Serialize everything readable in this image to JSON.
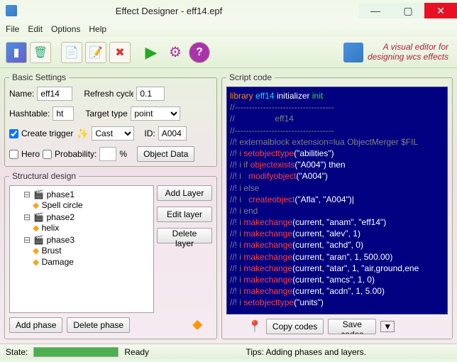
{
  "window": {
    "title": "Effect Designer - eff14.epf",
    "tagline_line1": "A visual editor for",
    "tagline_line2": "designing wcs effects"
  },
  "menu": {
    "file": "File",
    "edit": "Edit",
    "options": "Options",
    "help": "Help"
  },
  "basic": {
    "legend": "Basic Settings",
    "name_label": "Name:",
    "name_value": "eff14",
    "refresh_label": "Refresh cycle:",
    "refresh_value": "0.1",
    "hash_label": "Hashtable:",
    "hash_value": "ht",
    "target_label": "Target type:",
    "target_value": "point",
    "create_trigger_label": "Create trigger",
    "create_trigger_checked": true,
    "cast_value": "Cast",
    "id_label": "ID:",
    "id_value": "A004",
    "hero_label": "Hero",
    "hero_checked": false,
    "prob_label": "Probability:",
    "prob_value": "",
    "prob_unit": "%",
    "object_data_label": "Object Data"
  },
  "struct": {
    "legend": "Structural design",
    "tree": [
      {
        "label": "phase1",
        "children": [
          {
            "label": "Spell circle"
          }
        ]
      },
      {
        "label": "phase2",
        "children": [
          {
            "label": "helix"
          }
        ]
      },
      {
        "label": "phase3",
        "children": [
          {
            "label": "Brust"
          },
          {
            "label": "Damage"
          }
        ]
      }
    ],
    "add_layer": "Add Layer",
    "edit_layer": "Edit layer",
    "delete_layer": "Delete layer",
    "add_phase": "Add phase",
    "delete_phase": "Delete phase"
  },
  "script": {
    "legend": "Script code",
    "copy": "Copy codes",
    "save": "Save codes",
    "lines": [
      {
        "segs": [
          {
            "t": "library ",
            "c": "kw-orange"
          },
          {
            "t": "eff14",
            "c": "kw-cyan"
          },
          {
            "t": " initializer ",
            "c": "kw-white"
          },
          {
            "t": "init",
            "c": "kw-green"
          }
        ]
      },
      {
        "segs": [
          {
            "t": "//-----------------------------------",
            "c": "kw-gray"
          }
        ]
      },
      {
        "segs": [
          {
            "t": "//                 eff14",
            "c": "kw-gray"
          }
        ]
      },
      {
        "segs": [
          {
            "t": "//-----------------------------------",
            "c": "kw-gray"
          }
        ]
      },
      {
        "segs": [
          {
            "t": "//! externalblock extension=lua ObjectMerger $FIL",
            "c": "kw-gray"
          }
        ]
      },
      {
        "segs": [
          {
            "t": "//! i ",
            "c": "kw-gray"
          },
          {
            "t": "setobjecttype",
            "c": "kw-red"
          },
          {
            "t": "(\"abilities\")",
            "c": "kw-white"
          }
        ]
      },
      {
        "segs": [
          {
            "t": "//! i if ",
            "c": "kw-gray"
          },
          {
            "t": "objectexists",
            "c": "kw-red"
          },
          {
            "t": "(\"A004\") then",
            "c": "kw-white"
          }
        ]
      },
      {
        "segs": [
          {
            "t": "//! i   ",
            "c": "kw-gray"
          },
          {
            "t": "modifyobject",
            "c": "kw-red"
          },
          {
            "t": "(\"A004\")",
            "c": "kw-white"
          }
        ]
      },
      {
        "segs": [
          {
            "t": "//! i else",
            "c": "kw-gray"
          }
        ]
      },
      {
        "segs": [
          {
            "t": "//! i   ",
            "c": "kw-gray"
          },
          {
            "t": "createobject",
            "c": "kw-red"
          },
          {
            "t": "(\"Afla\", \"A004\")",
            "c": "kw-white"
          },
          {
            "t": "|",
            "c": "kw-white"
          }
        ]
      },
      {
        "segs": [
          {
            "t": "//! i end",
            "c": "kw-gray"
          }
        ]
      },
      {
        "segs": [
          {
            "t": "//! i ",
            "c": "kw-gray"
          },
          {
            "t": "makechange",
            "c": "kw-red"
          },
          {
            "t": "(current, \"anam\", \"eff14\")",
            "c": "kw-white"
          }
        ]
      },
      {
        "segs": [
          {
            "t": "//! i ",
            "c": "kw-gray"
          },
          {
            "t": "makechange",
            "c": "kw-red"
          },
          {
            "t": "(current, \"alev\", 1)",
            "c": "kw-white"
          }
        ]
      },
      {
        "segs": [
          {
            "t": "//! i ",
            "c": "kw-gray"
          },
          {
            "t": "makechange",
            "c": "kw-red"
          },
          {
            "t": "(current, \"achd\", 0)",
            "c": "kw-white"
          }
        ]
      },
      {
        "segs": [
          {
            "t": "//! i ",
            "c": "kw-gray"
          },
          {
            "t": "makechange",
            "c": "kw-red"
          },
          {
            "t": "(current, \"aran\", 1, 500.00)",
            "c": "kw-white"
          }
        ]
      },
      {
        "segs": [
          {
            "t": "//! i ",
            "c": "kw-gray"
          },
          {
            "t": "makechange",
            "c": "kw-red"
          },
          {
            "t": "(current, \"atar\", 1, \"air,ground,ene",
            "c": "kw-white"
          }
        ]
      },
      {
        "segs": [
          {
            "t": "//! i ",
            "c": "kw-gray"
          },
          {
            "t": "makechange",
            "c": "kw-red"
          },
          {
            "t": "(current, \"amcs\", 1, 0)",
            "c": "kw-white"
          }
        ]
      },
      {
        "segs": [
          {
            "t": "//! i ",
            "c": "kw-gray"
          },
          {
            "t": "makechange",
            "c": "kw-red"
          },
          {
            "t": "(current, \"acdn\", 1, 5.00)",
            "c": "kw-white"
          }
        ]
      },
      {
        "segs": [
          {
            "t": "//! i ",
            "c": "kw-gray"
          },
          {
            "t": "setobjecttype",
            "c": "kw-red"
          },
          {
            "t": "(\"units\")",
            "c": "kw-white"
          }
        ]
      }
    ]
  },
  "status": {
    "state_label": "State:",
    "ready": "Ready",
    "tips": "Tips: Adding phases and layers.",
    "progress_pct": 100
  }
}
